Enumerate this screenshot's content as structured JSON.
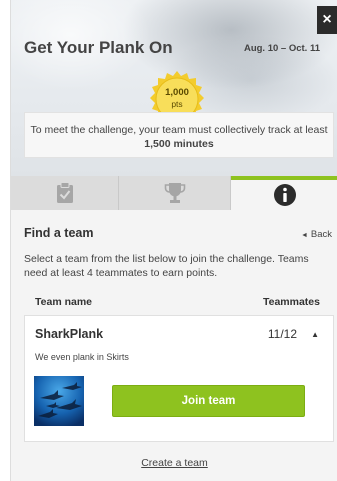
{
  "challenge": {
    "title": "Get Your Plank On",
    "dates": "Aug. 10 – Oct. 11",
    "points_value": "1,000",
    "points_label": "pts",
    "requirement_text": "To meet the challenge, your team must collectively track at least",
    "requirement_minutes": "1,500 minutes",
    "close_label": "×"
  },
  "tabs": [
    {
      "icon": "clipboard-check-icon",
      "active": false
    },
    {
      "icon": "trophy-icon",
      "active": false
    },
    {
      "icon": "info-icon",
      "active": true
    }
  ],
  "find_team": {
    "title": "Find a team",
    "back_label": "Back",
    "back_icon": "triangle-left-icon",
    "description": "Select a team from the list below to join the challenge. Teams need at least 4 teammates to earn points.",
    "column_team_name": "Team name",
    "column_teammates": "Teammates"
  },
  "teams": [
    {
      "name": "SharkPlank",
      "count": "11/12",
      "expanded_icon": "caret-up-icon",
      "description": "We even plank in Skirts",
      "image_icon": "sharks-image",
      "join_label": "Join team"
    }
  ],
  "footer": {
    "create_team_label": "Create a team"
  },
  "colors": {
    "accent_green": "#8ec21f",
    "badge_gold": "#f6d33d",
    "close_bg": "#2b2b2b"
  }
}
